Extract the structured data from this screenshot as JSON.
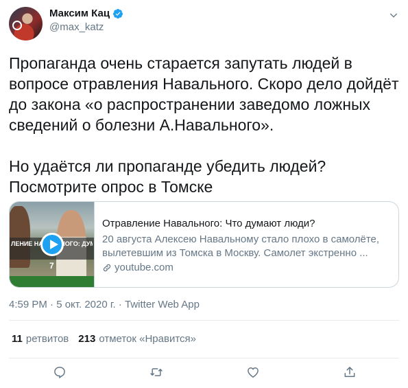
{
  "author": {
    "name": "Максим Кац",
    "handle": "@max_katz"
  },
  "tweet": {
    "text": "Пропаганда очень старается запутать людей в\nвопросе отравления Навального. Скоро дело дойдёт\nдо закона «о распространении заведомо ложных\nсведений о болезни А.Навального».\n\nНо удаётся ли пропаганде убедить людей?\nПосмотрите опрос в Томске"
  },
  "card": {
    "title": "Отравление Навального: Что думают люди?",
    "description": "20 августа Алексею Навальному стало плохо в самолёте, вылетевшим из Томска в Москву. Самолет экстренно ...",
    "domain": "youtube.com",
    "thumb_caption": "ЛЕНИЕ НАВАЛЬНОГО: ДУМАЮТ ЛЮДИ?",
    "thumb_number": "7"
  },
  "meta": "4:59 PM · 5 окт. 2020 г. · Twitter Web App",
  "stats": {
    "retweets_count": "11",
    "retweets_label": "ретвитов",
    "likes_count": "213",
    "likes_label": "отметок «Нравится»"
  },
  "colors": {
    "accent": "#1da1f2",
    "secondary_text": "#657786",
    "border": "#ccd6dd"
  },
  "icons": [
    "verified-badge-icon",
    "chevron-down-icon",
    "play-icon",
    "link-icon",
    "reply-icon",
    "retweet-icon",
    "like-icon",
    "share-icon"
  ]
}
